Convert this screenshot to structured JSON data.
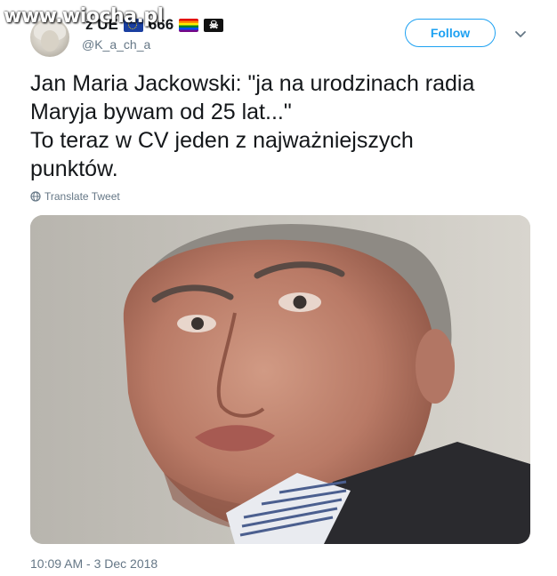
{
  "watermark": "www.wiocha.pl",
  "tweet": {
    "display_name_suffix": "z UE",
    "name_number": "666",
    "handle": "@K_a_ch_a",
    "follow_label": "Follow",
    "text_lines": [
      "Jan Maria Jackowski: \"ja na urodzinach radia",
      "Maryja bywam od 25 lat...\"",
      "To teraz w CV jeden z najważniejszych",
      "punktów."
    ],
    "translate_label": "Translate Tweet",
    "timestamp": "10:09 AM - 3 Dec 2018"
  },
  "icons": {
    "eu_flag": "eu-flag-icon",
    "rainbow": "rainbow-flag-icon",
    "pirate": "pirate-flag-icon",
    "globe": "globe-icon",
    "chevron": "chevron-down-icon"
  },
  "colors": {
    "accent": "#1da1f2",
    "secondary_text": "#657786",
    "primary_text": "#14171a"
  }
}
